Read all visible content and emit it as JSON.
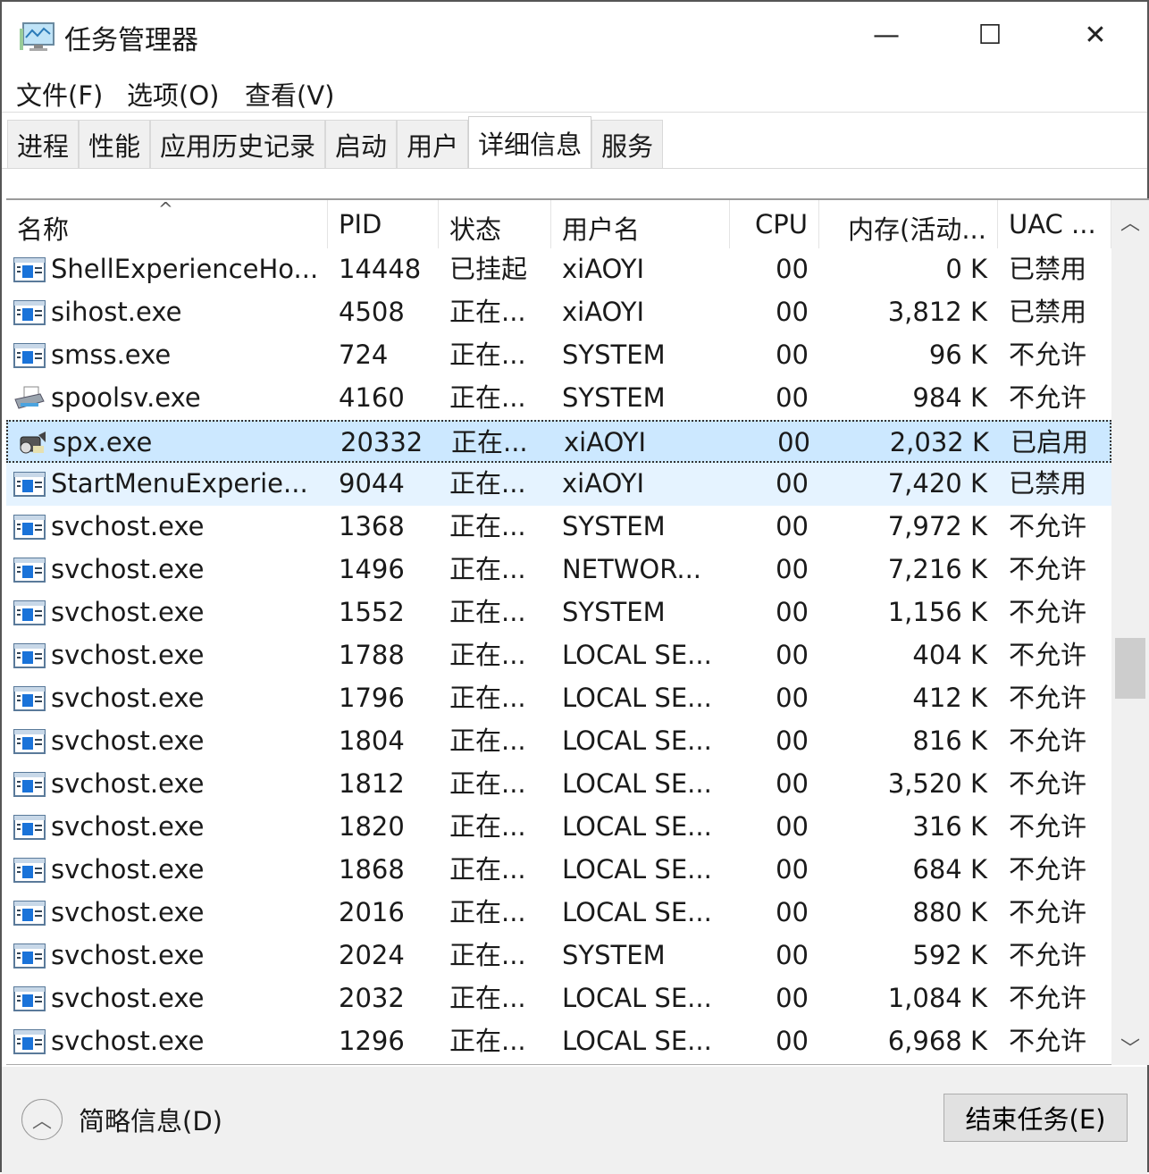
{
  "window": {
    "title": "任务管理器",
    "minimize": "—",
    "maximize": "☐",
    "close": "✕"
  },
  "menu": [
    "文件(F)",
    "选项(O)",
    "查看(V)"
  ],
  "tabs": [
    "进程",
    "性能",
    "应用历史记录",
    "启动",
    "用户",
    "详细信息",
    "服务"
  ],
  "active_tab": 5,
  "columns": [
    "名称",
    "PID",
    "状态",
    "用户名",
    "CPU",
    "内存(活动...",
    "UAC ..."
  ],
  "rows": [
    [
      "ShellExperienceHo...",
      "14448",
      "已挂起",
      "xiAOYI",
      "00",
      "0 K",
      "已禁用",
      "app"
    ],
    [
      "sihost.exe",
      "4508",
      "正在...",
      "xiAOYI",
      "00",
      "3,812 K",
      "已禁用",
      "app"
    ],
    [
      "smss.exe",
      "724",
      "正在...",
      "SYSTEM",
      "00",
      "96 K",
      "不允许",
      "app"
    ],
    [
      "spoolsv.exe",
      "4160",
      "正在...",
      "SYSTEM",
      "00",
      "984 K",
      "不允许",
      "printer"
    ],
    [
      "spx.exe",
      "20332",
      "正在...",
      "xiAOYI",
      "00",
      "2,032 K",
      "已启用",
      "camera"
    ],
    [
      "StartMenuExperie...",
      "9044",
      "正在...",
      "xiAOYI",
      "00",
      "7,420 K",
      "已禁用",
      "app"
    ],
    [
      "svchost.exe",
      "1368",
      "正在...",
      "SYSTEM",
      "00",
      "7,972 K",
      "不允许",
      "app"
    ],
    [
      "svchost.exe",
      "1496",
      "正在...",
      "NETWOR...",
      "00",
      "7,216 K",
      "不允许",
      "app"
    ],
    [
      "svchost.exe",
      "1552",
      "正在...",
      "SYSTEM",
      "00",
      "1,156 K",
      "不允许",
      "app"
    ],
    [
      "svchost.exe",
      "1788",
      "正在...",
      "LOCAL SE...",
      "00",
      "404 K",
      "不允许",
      "app"
    ],
    [
      "svchost.exe",
      "1796",
      "正在...",
      "LOCAL SE...",
      "00",
      "412 K",
      "不允许",
      "app"
    ],
    [
      "svchost.exe",
      "1804",
      "正在...",
      "LOCAL SE...",
      "00",
      "816 K",
      "不允许",
      "app"
    ],
    [
      "svchost.exe",
      "1812",
      "正在...",
      "LOCAL SE...",
      "00",
      "3,520 K",
      "不允许",
      "app"
    ],
    [
      "svchost.exe",
      "1820",
      "正在...",
      "LOCAL SE...",
      "00",
      "316 K",
      "不允许",
      "app"
    ],
    [
      "svchost.exe",
      "1868",
      "正在...",
      "LOCAL SE...",
      "00",
      "684 K",
      "不允许",
      "app"
    ],
    [
      "svchost.exe",
      "2016",
      "正在...",
      "LOCAL SE...",
      "00",
      "880 K",
      "不允许",
      "app"
    ],
    [
      "svchost.exe",
      "2024",
      "正在...",
      "SYSTEM",
      "00",
      "592 K",
      "不允许",
      "app"
    ],
    [
      "svchost.exe",
      "2032",
      "正在...",
      "LOCAL SE...",
      "00",
      "1,084 K",
      "不允许",
      "app"
    ],
    [
      "svchost.exe",
      "1296",
      "正在...",
      "LOCAL SE...",
      "00",
      "6,968 K",
      "不允许",
      "app"
    ]
  ],
  "selected_row": 4,
  "hover_row": 5,
  "footer": {
    "fewer_details": "简略信息(D)",
    "end_task": "结束任务(E)"
  }
}
